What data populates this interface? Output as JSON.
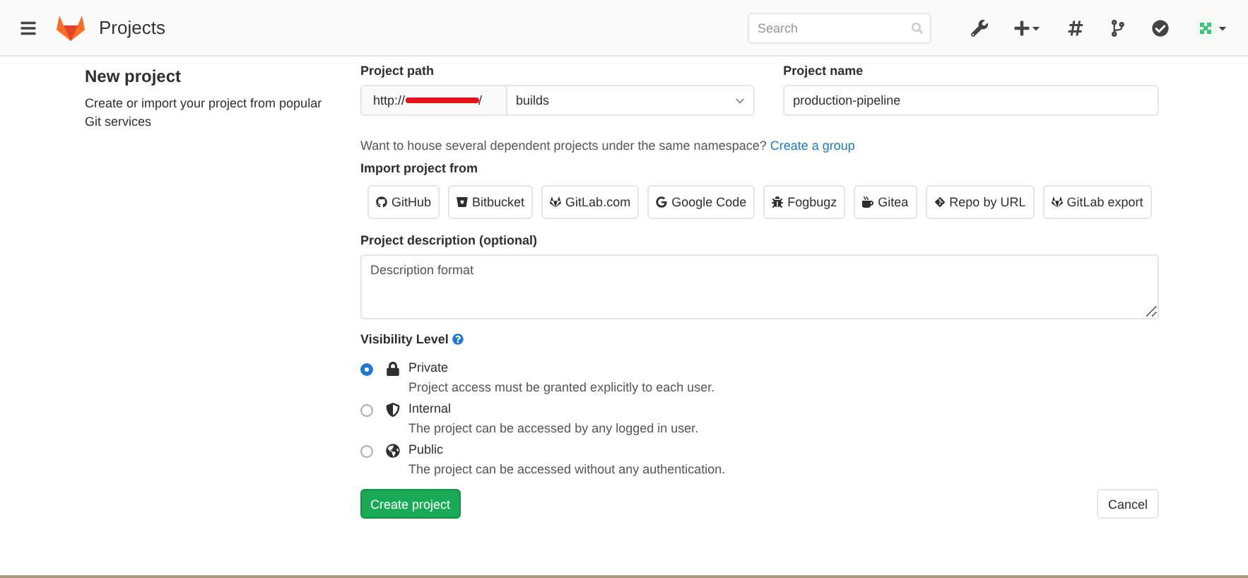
{
  "header": {
    "title": "Projects",
    "search": {
      "placeholder": "Search"
    }
  },
  "intro": {
    "title": "New project",
    "text": "Create or import your project from popular Git services"
  },
  "project_path": {
    "label": "Project path",
    "prefix_start": "http://",
    "prefix_end": "/",
    "value": "builds"
  },
  "project_name": {
    "label": "Project name",
    "value": "production-pipeline"
  },
  "group_hint": {
    "text": "Want to house several dependent projects under the same namespace?",
    "link": "Create a group"
  },
  "import": {
    "label": "Import project from",
    "sources": [
      "GitHub",
      "Bitbucket",
      "GitLab.com",
      "Google Code",
      "Fogbugz",
      "Gitea",
      "Repo by URL",
      "GitLab export"
    ]
  },
  "description": {
    "label": "Project description (optional)",
    "placeholder": "Description format"
  },
  "visibility": {
    "label": "Visibility Level",
    "options": [
      {
        "name": "Private",
        "text": "Project access must be granted explicitly to each user.",
        "selected": true
      },
      {
        "name": "Internal",
        "text": "The project can be accessed by any logged in user.",
        "selected": false
      },
      {
        "name": "Public",
        "text": "The project can be accessed without any authentication.",
        "selected": false
      }
    ]
  },
  "buttons": {
    "create": "Create project",
    "cancel": "Cancel"
  }
}
